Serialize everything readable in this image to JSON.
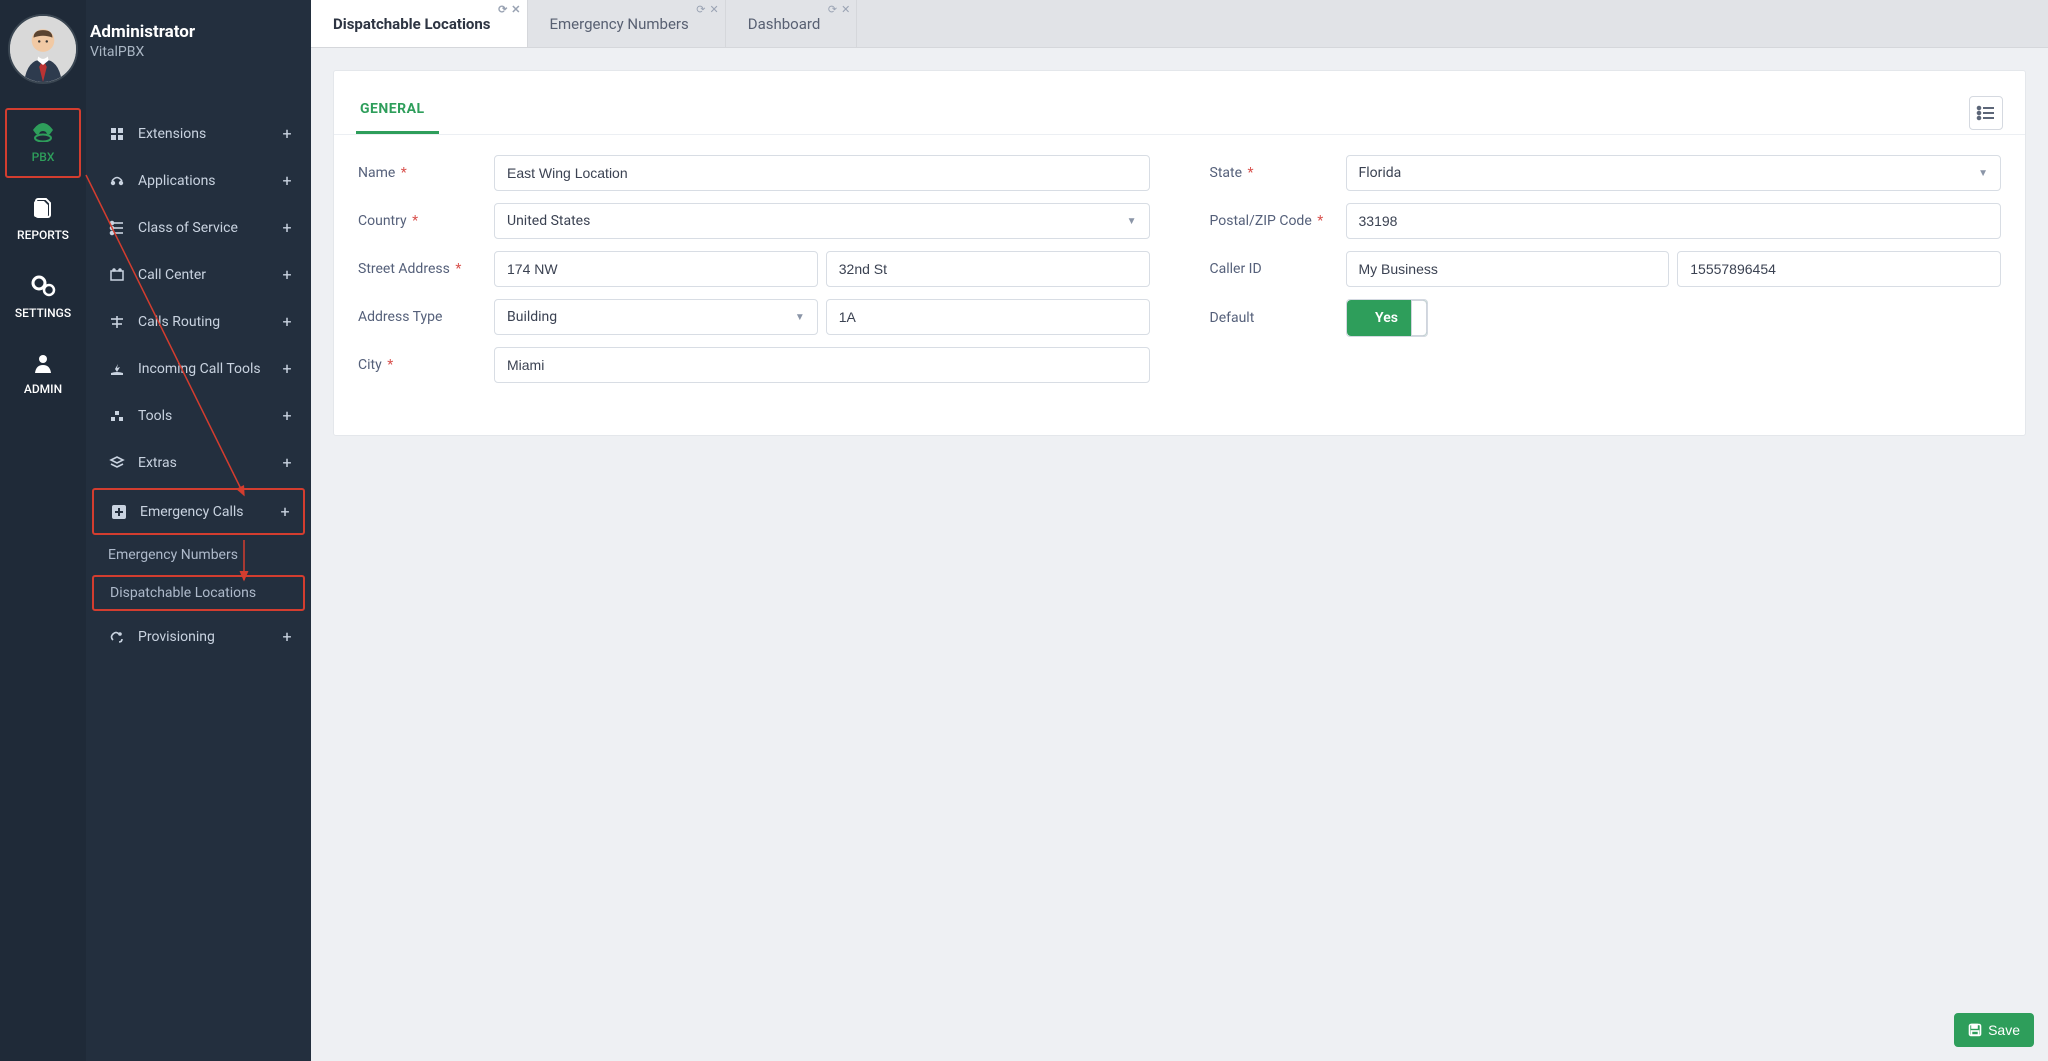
{
  "user": {
    "name": "Administrator",
    "sub": "VitalPBX"
  },
  "rail": {
    "pbx": "PBX",
    "reports": "REPORTS",
    "settings": "SETTINGS",
    "admin": "ADMIN"
  },
  "sidenav": {
    "extensions": "Extensions",
    "applications": "Applications",
    "class_of_service": "Class of Service",
    "call_center": "Call Center",
    "calls_routing": "Calls Routing",
    "incoming_call_tools": "Incoming Call Tools",
    "tools": "Tools",
    "extras": "Extras",
    "emergency_calls": "Emergency Calls",
    "emergency_numbers": "Emergency Numbers",
    "dispatchable_locations": "Dispatchable Locations",
    "provisioning": "Provisioning"
  },
  "tabs": {
    "dispatchable_locations": "Dispatchable Locations",
    "emergency_numbers": "Emergency Numbers",
    "dashboard": "Dashboard"
  },
  "pill": {
    "general": "GENERAL"
  },
  "form": {
    "labels": {
      "name": "Name",
      "country": "Country",
      "street_address": "Street Address",
      "address_type": "Address Type",
      "city": "City",
      "state": "State",
      "postal_zip": "Postal/ZIP Code",
      "caller_id": "Caller ID",
      "default": "Default"
    },
    "values": {
      "name": "East Wing Location",
      "country": "United States",
      "street1": "174 NW",
      "street2": "32nd St",
      "address_type": "Building",
      "address_type_val": "1A",
      "city": "Miami",
      "state": "Florida",
      "postal_zip": "33198",
      "caller_id_name": "My Business",
      "caller_id_num": "15557896454",
      "default_toggle": "Yes"
    }
  },
  "buttons": {
    "save": "Save"
  }
}
